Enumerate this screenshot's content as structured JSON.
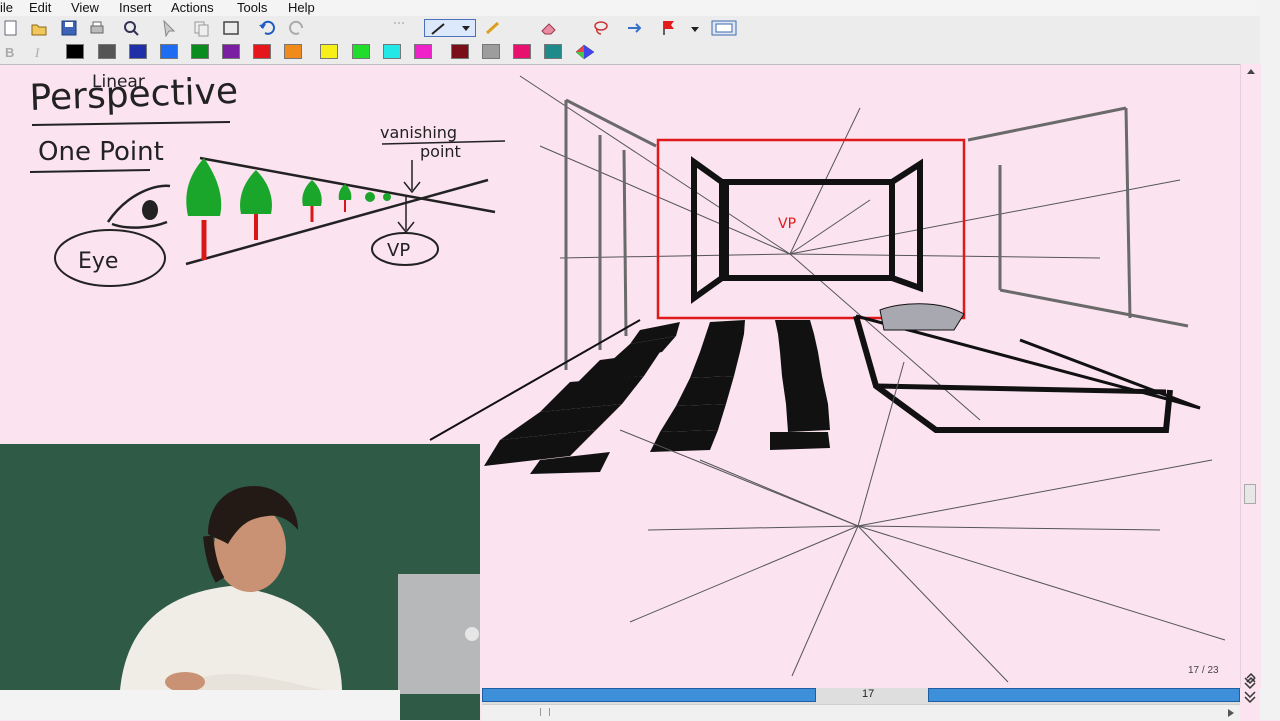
{
  "menu": {
    "items": [
      {
        "label": "ile"
      },
      {
        "label": "Edit"
      },
      {
        "label": "View"
      },
      {
        "label": "Insert"
      },
      {
        "label": "Actions"
      },
      {
        "label": "Tools"
      },
      {
        "label": "Help"
      }
    ]
  },
  "toolbar": {
    "icons": [
      "new-page-icon",
      "open-icon",
      "save-icon",
      "find-icon",
      "pointer-icon",
      "copy-icon",
      "select-icon",
      "undo-icon",
      "redo-icon",
      "pen-tool-icon",
      "highlighter-icon",
      "eraser-icon",
      "lasso-icon",
      "insert-space-icon",
      "flag-icon",
      "fullscreen-icon"
    ]
  },
  "palette": {
    "colors": [
      "#000000",
      "#555555",
      "#1f2fa8",
      "#1e6cf2",
      "#0a8c1e",
      "#7b1fa2",
      "#e5171c",
      "#f08a1a",
      "#f6ef1a",
      "#21dd2b",
      "#22e8e8",
      "#ef22c9",
      "#7a0f1a",
      "#9d9d9d",
      "#e8126e",
      "#1e8a8a"
    ]
  },
  "whiteboard": {
    "title_top": "Linear",
    "title": "Perspective",
    "subtitle": "One Point",
    "annotation_top": "vanishing",
    "annotation_bottom": "point",
    "label_vp": "VP",
    "label_eye": "Eye",
    "label_vp_room": "VP"
  },
  "pager": {
    "current_page": "17",
    "page_count": "17 / 23"
  },
  "video": {
    "description": "presenter webcam"
  }
}
